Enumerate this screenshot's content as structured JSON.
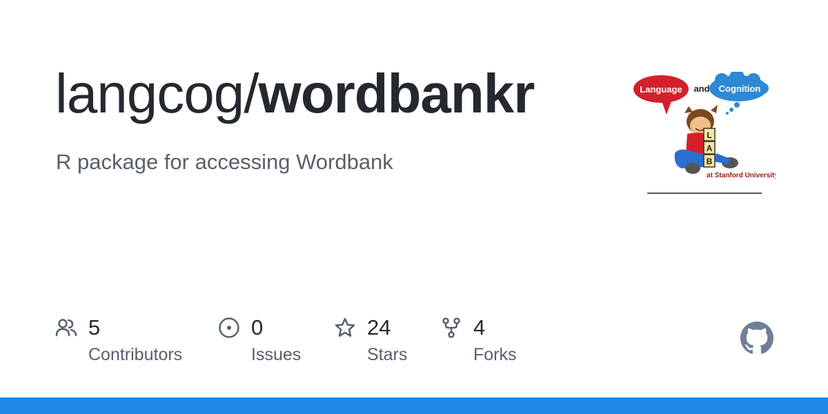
{
  "repo": {
    "owner": "langcog/",
    "name": "wordbankr",
    "description": "R package for accessing Wordbank"
  },
  "logo": {
    "speech_bubble": "Language",
    "and": "and",
    "thought_bubble": "Cognition",
    "blocks": [
      "L",
      "A",
      "B"
    ],
    "caption": "at Stanford University"
  },
  "stats": [
    {
      "icon": "people-icon",
      "value": "5",
      "label": "Contributors"
    },
    {
      "icon": "issue-icon",
      "value": "0",
      "label": "Issues"
    },
    {
      "icon": "star-icon",
      "value": "24",
      "label": "Stars"
    },
    {
      "icon": "fork-icon",
      "value": "4",
      "label": "Forks"
    }
  ],
  "colors": {
    "title": "#24292f",
    "muted": "#57606a",
    "icon": "#57606a",
    "bottom_bar": "#1f88e5",
    "github_mark": "#6e7f96"
  }
}
